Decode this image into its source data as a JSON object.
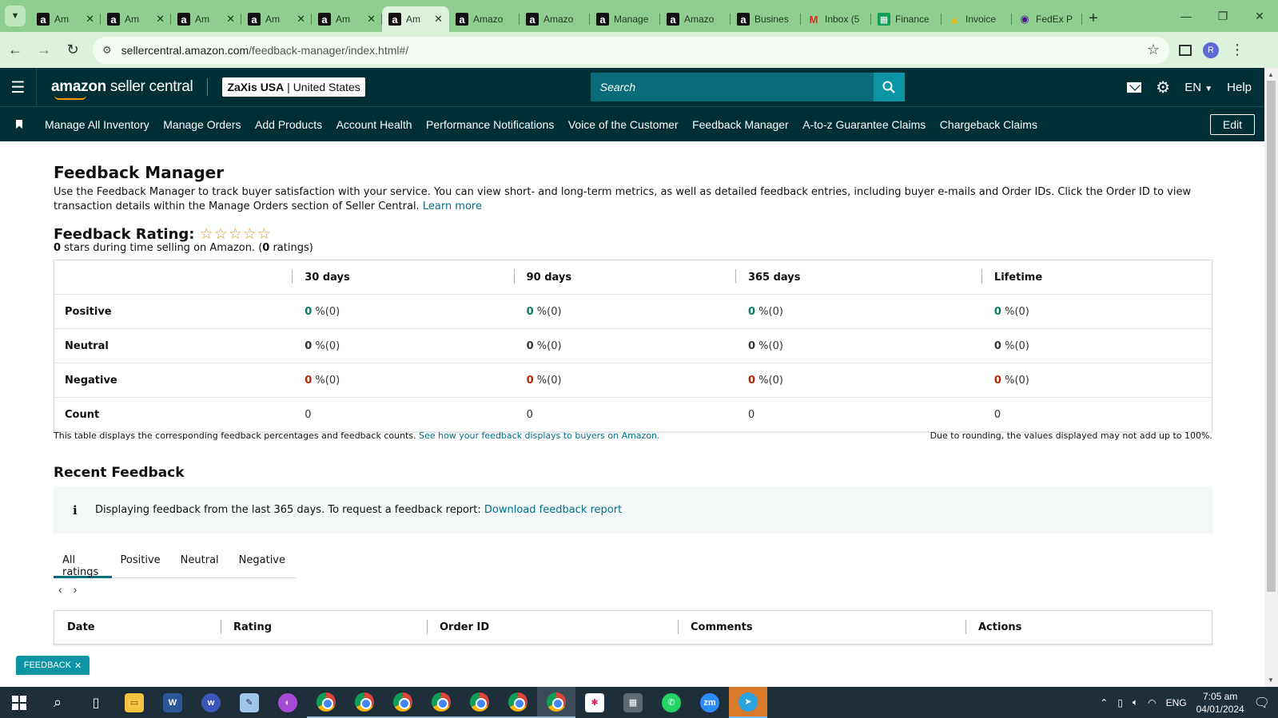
{
  "browser": {
    "tabs": [
      {
        "title": "Am",
        "icon": "amazon",
        "close": true
      },
      {
        "title": "Am",
        "icon": "amazon",
        "close": true
      },
      {
        "title": "Am",
        "icon": "amazon",
        "close": true
      },
      {
        "title": "Am",
        "icon": "amazon",
        "close": true
      },
      {
        "title": "Am",
        "icon": "amazon",
        "close": true
      },
      {
        "title": "Am",
        "icon": "amazon",
        "close": true,
        "active": true
      },
      {
        "title": "Amazo",
        "icon": "amazon"
      },
      {
        "title": "Amazo",
        "icon": "amazon"
      },
      {
        "title": "Manage",
        "icon": "amazon"
      },
      {
        "title": "Amazo",
        "icon": "amazon"
      },
      {
        "title": "Busines",
        "icon": "amazon"
      },
      {
        "title": "Inbox (5",
        "icon": "gmail"
      },
      {
        "title": "Finance",
        "icon": "sheets"
      },
      {
        "title": "Invoice",
        "icon": "drive"
      },
      {
        "title": "FedEx P",
        "icon": "fedex"
      }
    ],
    "url_host": "sellercentral.amazon.com",
    "url_path": "/feedback-manager/index.html#/"
  },
  "header": {
    "logo_bold": "amazon",
    "logo_rest": " seller central",
    "account_name": "ZaXis USA",
    "account_region": "United States",
    "search_placeholder": "Search",
    "lang": "EN",
    "help": "Help"
  },
  "nav": {
    "items": [
      "Manage All Inventory",
      "Manage Orders",
      "Add Products",
      "Account Health",
      "Performance Notifications",
      "Voice of the Customer",
      "Feedback Manager",
      "A-to-z Guarantee Claims",
      "Chargeback Claims"
    ],
    "edit": "Edit"
  },
  "page": {
    "title": "Feedback Manager",
    "description": "Use the Feedback Manager to track buyer satisfaction with your service. You can view short- and long-term metrics, as well as detailed feedback entries, including buyer e-mails and Order IDs. Click the Order ID to view transaction details within the Manage Orders section of Seller Central.",
    "learn_more": "Learn more",
    "rating_label": "Feedback Rating:",
    "stars": "☆☆☆☆☆",
    "rating_stars_value": "0",
    "rating_mid": " stars during time selling on Amazon. (",
    "rating_count": "0",
    "rating_end": " ratings)"
  },
  "feedback_table": {
    "columns": [
      "30 days",
      "90 days",
      "365 days",
      "Lifetime"
    ],
    "rows": [
      {
        "label": "Positive",
        "values": [
          "0",
          "0",
          "0",
          "0"
        ],
        "suffix": " %(0)"
      },
      {
        "label": "Neutral",
        "values": [
          "0",
          "0",
          "0",
          "0"
        ],
        "suffix": " %(0)"
      },
      {
        "label": "Negative",
        "values": [
          "0",
          "0",
          "0",
          "0"
        ],
        "suffix": " %(0)"
      },
      {
        "label": "Count",
        "values": [
          "0",
          "0",
          "0",
          "0"
        ],
        "suffix": ""
      }
    ],
    "note": "This table displays the corresponding feedback percentages and feedback counts.",
    "note_link": "See how your feedback displays to buyers on Amazon.",
    "rounding_note": "Due to rounding, the values displayed may not add up to 100%."
  },
  "recent": {
    "title": "Recent Feedback",
    "info_icon": "i",
    "info": "Displaying feedback from the last 365 days. To request a feedback report:",
    "info_link": "Download feedback report",
    "tabs": [
      "All ratings",
      "Positive",
      "Neutral",
      "Negative"
    ],
    "columns": [
      "Date",
      "Rating",
      "Order ID",
      "Comments",
      "Actions"
    ]
  },
  "feedback_badge": "FEEDBACK",
  "taskbar": {
    "lang": "ENG",
    "time": "7:05 am",
    "date": "04/01/2024"
  },
  "colors": {
    "seller_central_bg": "#002f36",
    "link": "#007185",
    "positive": "#067d62",
    "negative": "#b12704",
    "browser_frame": "#8fce8f"
  }
}
